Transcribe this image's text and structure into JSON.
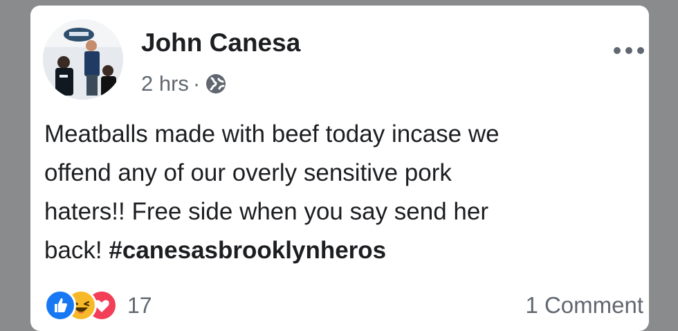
{
  "post": {
    "author": "John Canesa",
    "time": "2 hrs",
    "separator": "·",
    "privacy_icon": "globe-icon",
    "more_icon": "more-options-icon",
    "text_body": "Meatballs made with beef today incase we\noffend any of our overly sensitive pork\nhaters!! Free side when you say send her\nback! ",
    "hashtag": "#canesasbrooklynheros",
    "reactions": {
      "icons": [
        "like-icon",
        "haha-icon",
        "love-icon"
      ],
      "count": "17"
    },
    "comments_label": "1 Comment"
  },
  "colors": {
    "like": "#1877f2",
    "haha": "#f7b928",
    "love": "#f33e58",
    "secondary_text": "#606770"
  }
}
